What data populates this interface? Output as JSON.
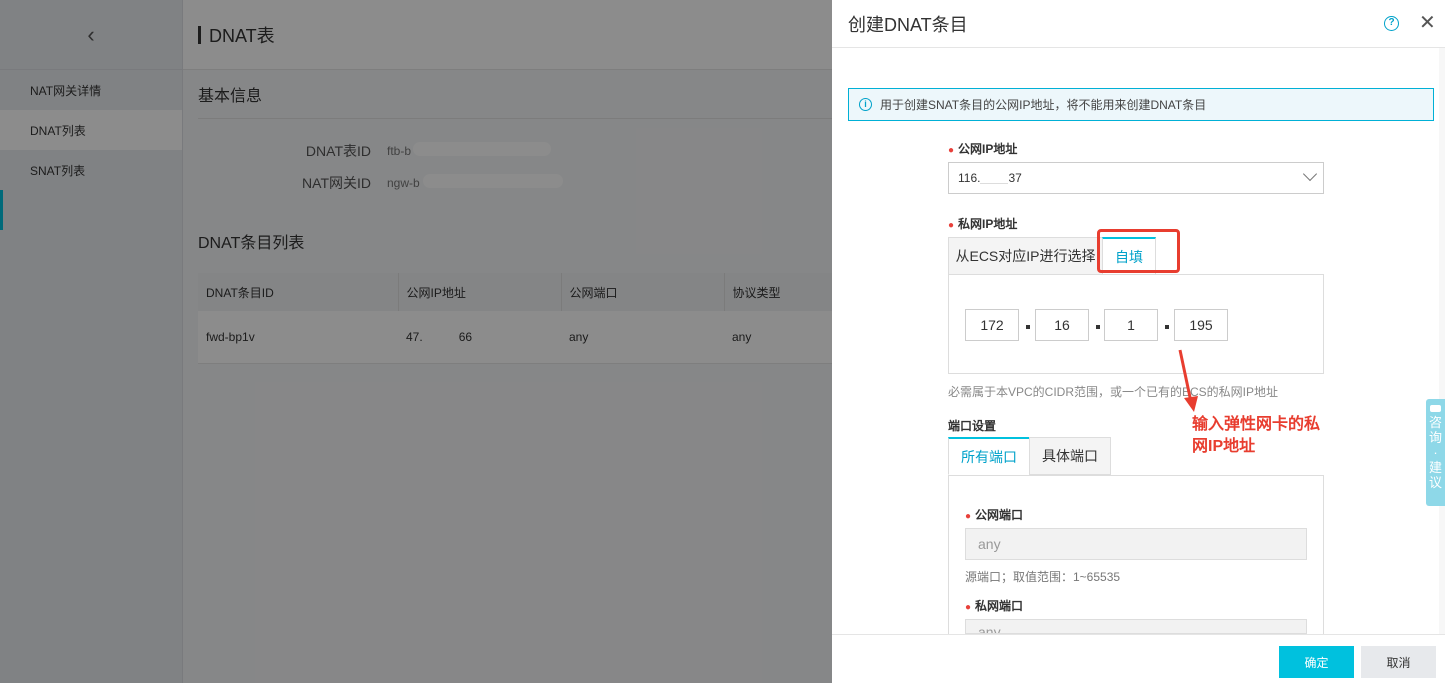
{
  "sidebar": {
    "back_icon": "chevron-left-icon",
    "items": [
      {
        "label": "NAT网关详情"
      },
      {
        "label": "DNAT列表"
      },
      {
        "label": "SNAT列表"
      }
    ]
  },
  "main": {
    "title": "DNAT表",
    "basic_info_title": "基本信息",
    "fields": [
      {
        "label": "DNAT表ID",
        "value": "ftb-b"
      },
      {
        "label": "NAT网关ID",
        "value": "ngw-b"
      }
    ],
    "list_title": "DNAT条目列表",
    "table": {
      "headers": [
        "DNAT条目ID",
        "公网IP地址",
        "公网端口",
        "协议类型"
      ],
      "rows": [
        [
          "fwd-bp1v",
          "47.",
          "66",
          "any",
          "any"
        ]
      ]
    }
  },
  "panel": {
    "title": "创建DNAT条目",
    "help_icon": "question-circle-icon",
    "close_icon": "close-icon",
    "notice": "用于创建SNAT条目的公网IP地址，将不能用来创建DNAT条目",
    "public_ip_label": "公网IP地址",
    "public_ip_value_prefix": "116.",
    "public_ip_value_suffix": "37",
    "private_ip_label": "私网IP地址",
    "private_ip_tabs": [
      "从ECS对应IP进行选择",
      "自填"
    ],
    "ip_octets": [
      "172",
      "16",
      "1",
      "195"
    ],
    "private_ip_hint": "必需属于本VPC的CIDR范围，或一个已有的ECS的私网IP地址",
    "port_settings_label": "端口设置",
    "port_tabs": [
      "所有端口",
      "具体端口"
    ],
    "public_port_label": "公网端口",
    "public_port_placeholder": "any",
    "public_port_hint": "源端口；取值范围：1~65535",
    "private_port_label": "私网端口",
    "private_port_placeholder": "any",
    "annotation": [
      "输入弹性网卡的私",
      "网IP地址"
    ],
    "confirm_label": "确定",
    "cancel_label": "取消",
    "feedback_chars": [
      "咨",
      "询",
      "·",
      "建",
      "议"
    ]
  },
  "colors": {
    "accent": "#00c1de",
    "annotation_red": "#e83d2f"
  }
}
